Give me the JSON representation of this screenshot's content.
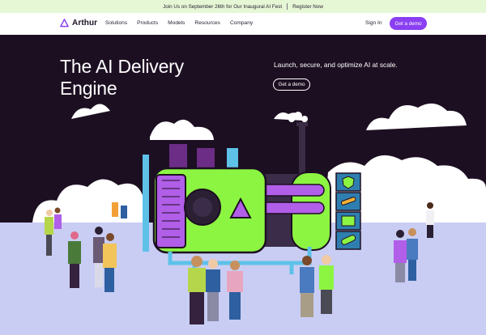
{
  "announcement": {
    "text": "Join Us on September 26th for Our Inaugural AI Fest",
    "link": "Register Now"
  },
  "brand": {
    "name": "Arthur"
  },
  "nav": {
    "items": [
      "Solutions",
      "Products",
      "Models",
      "Resources",
      "Company"
    ],
    "signin": "Sign In",
    "cta": "Get a demo"
  },
  "hero": {
    "title": "The AI Delivery Engine",
    "subtitle": "Launch, secure, and optimize AI at scale.",
    "cta": "Get a demo"
  },
  "colors": {
    "accent": "#8a3ff2",
    "hero_bg": "#1d0f22",
    "announce_bg": "#e6f7d6",
    "machine_green": "#8cf542",
    "ground": "#c9cdf3"
  },
  "icons": [
    "arthur-logo-icon",
    "shield-icon",
    "wrench-icon",
    "list-icon",
    "capsule-icon"
  ]
}
